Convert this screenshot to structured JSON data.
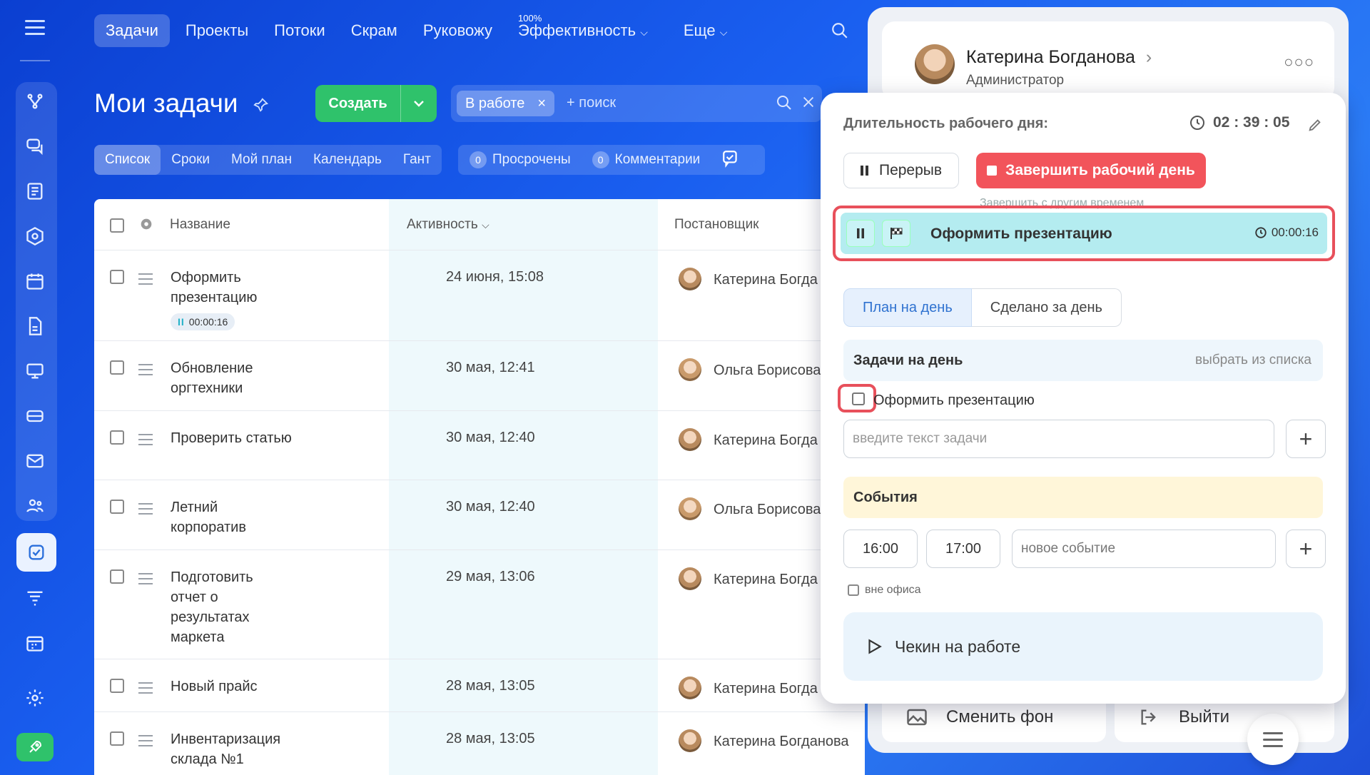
{
  "topnav": {
    "tabs": [
      "Задачи",
      "Проекты",
      "Потоки",
      "Скрам",
      "Руковожу",
      "Эффективность",
      "Еще"
    ],
    "efficiency_badge": "100%"
  },
  "page": {
    "title": "Мои задачи",
    "create_label": "Создать",
    "filter_chip": "В работе",
    "search_placeholder": "+ поиск"
  },
  "views": [
    "Список",
    "Сроки",
    "Мой план",
    "Календарь",
    "Гант"
  ],
  "counters": [
    {
      "num": "0",
      "label": "Просрочены"
    },
    {
      "num": "0",
      "label": "Комментарии"
    }
  ],
  "table": {
    "headers": {
      "name": "Название",
      "activity": "Активность",
      "creator": "Постановщик"
    },
    "rows": [
      {
        "name": "Оформить презентацию",
        "date": "24 июня, 15:08",
        "person": "Катерина Богда",
        "timer": "00:00:16"
      },
      {
        "name": "Обновление оргтехники",
        "date": "30 мая, 12:41",
        "person": "Ольга Борисова"
      },
      {
        "name": "Проверить статью",
        "date": "30 мая, 12:40",
        "person": "Катерина Богда"
      },
      {
        "name": "Летний корпоратив",
        "date": "30 мая, 12:40",
        "person": "Ольга Борисова"
      },
      {
        "name": "Подготовить отчет о результатах маркета",
        "date": "29 мая, 13:06",
        "person": "Катерина Богда"
      },
      {
        "name": "Новый прайс",
        "date": "28 мая, 13:05",
        "person": "Катерина Богда"
      },
      {
        "name": "Инвентаризация склада №1",
        "date": "28 мая, 13:05",
        "person": "Катерина Богданова"
      }
    ]
  },
  "profile": {
    "name": "Катерина Богданова",
    "role": "Администратор",
    "change_bg": "Сменить фон",
    "logout": "Выйти"
  },
  "workday": {
    "heading": "Длительность рабочего дня:",
    "duration": "02 : 39 : 05",
    "pause_label": "Перерыв",
    "end_label": "Завершить рабочий день",
    "other_time": "Завершить с другим временем",
    "current_task": "Оформить презентацию",
    "current_time": "00:00:16",
    "tab_plan": "План на день",
    "tab_done": "Сделано за день",
    "tasks_heading": "Задачи на день",
    "choose_from_list": "выбрать из списка",
    "planned_task": "Оформить презентацию",
    "task_input_placeholder": "введите текст задачи",
    "events_heading": "События",
    "event_from": "16:00",
    "event_to": "17:00",
    "event_placeholder": "новое событие",
    "out_of_office": "вне офиса",
    "checkin": "Чекин на работе"
  }
}
